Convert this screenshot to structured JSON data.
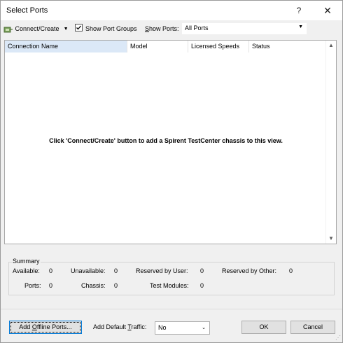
{
  "window": {
    "title": "Select Ports",
    "help_glyph": "?",
    "close_glyph": "✕"
  },
  "toolbar": {
    "connect_label": "Connect/Create",
    "connect_dropdown": "▼",
    "show_port_groups_label": "Show Port Groups",
    "show_port_groups_checked": true,
    "show_ports_label": "Show Ports:",
    "show_ports_value": "All Ports"
  },
  "grid": {
    "columns": [
      "Connection Name",
      "Model",
      "Licensed Speeds",
      "Status"
    ],
    "empty_message": "Click 'Connect/Create' button to add a Spirent TestCenter chassis to this view."
  },
  "summary": {
    "title": "Summary",
    "available_label": "Available:",
    "available": "0",
    "unavailable_label": "Unavailable:",
    "unavailable": "0",
    "reserved_user_label": "Reserved by User:",
    "reserved_user": "0",
    "reserved_other_label": "Reserved by Other:",
    "reserved_other": "0",
    "ports_label": "Ports:",
    "ports": "0",
    "chassis_label": "Chassis:",
    "chassis": "0",
    "test_modules_label": "Test Modules:",
    "test_modules": "0"
  },
  "footer": {
    "add_offline_label": "Add Offline Ports...",
    "add_traffic_label": "Add Default Traffic:",
    "traffic_value": "No",
    "ok_label": "OK",
    "cancel_label": "Cancel"
  },
  "icons": {
    "connect": "plug-icon",
    "dropdown": "chevron-down-icon",
    "check": "checkmark-icon",
    "scroll_up": "scroll-up-icon",
    "scroll_down": "scroll-down-icon"
  }
}
